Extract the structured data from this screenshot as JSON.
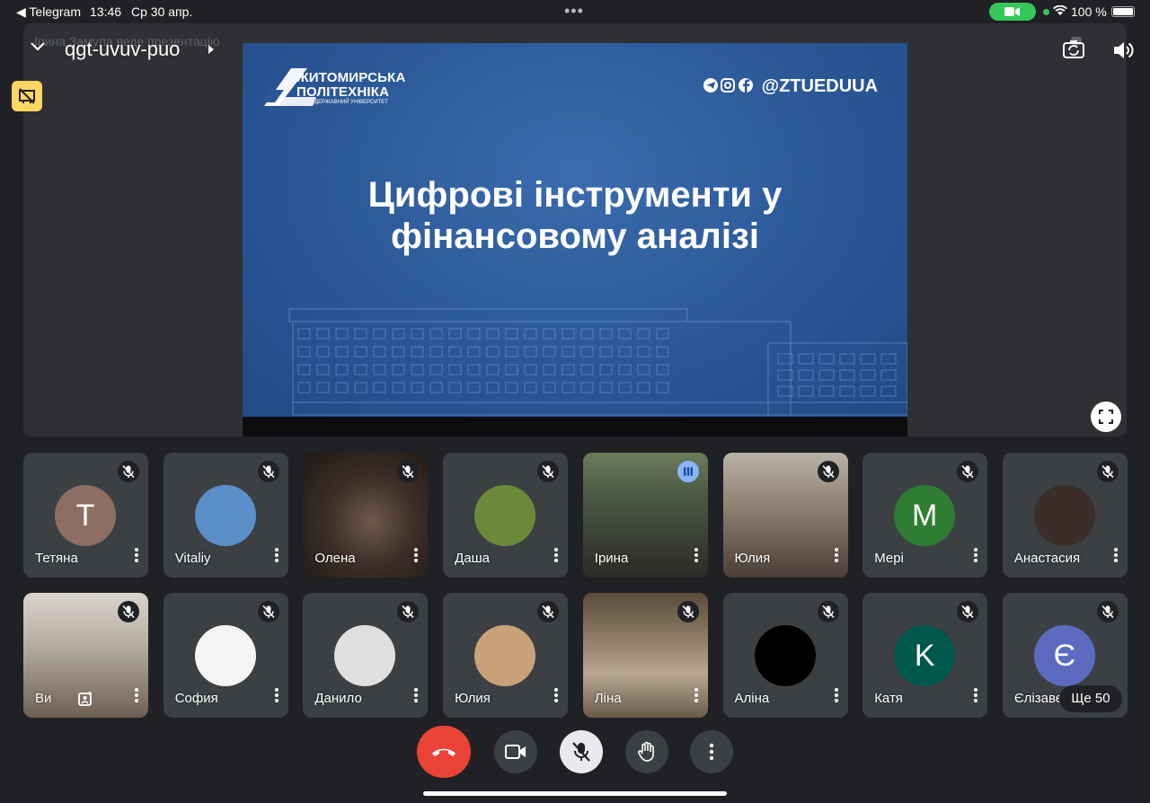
{
  "status_bar": {
    "back_app": "◀ Telegram",
    "time": "13:46",
    "date": "Ср 30 апр.",
    "battery": "100 %"
  },
  "meeting": {
    "presenter_note": "Ірина Замула веде презентацію",
    "code": "qgt-uvuv-puo"
  },
  "slide": {
    "logo_line1": "ЖИТОМИРСЬКА",
    "logo_line2": "ПОЛІТЕХНІКА",
    "logo_line3": "ДЕРЖАВНИЙ УНІВЕРСИТЕТ",
    "social_handle": "@ZTUEDUUA",
    "title_line1": "Цифрові інструменти у",
    "title_line2": "фінансовому аналізі"
  },
  "participants_row1": [
    {
      "name": "Тетяна",
      "initial": "T",
      "avatar_color": "#8d6e63",
      "state": "muted"
    },
    {
      "name": "Vitaliy",
      "initial": "",
      "avatar_color": "#5b8fc9",
      "state": "muted"
    },
    {
      "name": "Олена",
      "initial": "",
      "avatar_color": "",
      "state": "muted"
    },
    {
      "name": "Даша",
      "initial": "",
      "avatar_color": "#6a8a3a",
      "state": "muted"
    },
    {
      "name": "Ірина",
      "initial": "",
      "avatar_color": "",
      "state": "speaking"
    },
    {
      "name": "Юлия",
      "initial": "",
      "avatar_color": "",
      "state": "muted"
    },
    {
      "name": "Мері",
      "initial": "M",
      "avatar_color": "#2e7d32",
      "state": "muted"
    },
    {
      "name": "Анастасия",
      "initial": "",
      "avatar_color": "#3a2d2a",
      "state": "muted"
    }
  ],
  "participants_row2": [
    {
      "name": "Ви",
      "initial": "",
      "avatar_color": "",
      "state": "muted"
    },
    {
      "name": "София",
      "initial": "",
      "avatar_color": "#f5f5f5",
      "state": "muted"
    },
    {
      "name": "Данило",
      "initial": "",
      "avatar_color": "#e0e0e0",
      "state": "muted"
    },
    {
      "name": "Юлия",
      "initial": "",
      "avatar_color": "#c9a27a",
      "state": "muted"
    },
    {
      "name": "Ліна",
      "initial": "",
      "avatar_color": "",
      "state": "muted"
    },
    {
      "name": "Аліна",
      "initial": "",
      "avatar_color": "#000000",
      "state": "muted"
    },
    {
      "name": "Катя",
      "initial": "K",
      "avatar_color": "#00574b",
      "state": "muted"
    },
    {
      "name": "Єлізаве",
      "initial": "Є",
      "avatar_color": "#5c6bc0",
      "state": "muted"
    }
  ],
  "more_people": "Ще 50",
  "controls": {
    "end_call_color": "#ea4335",
    "icons": [
      "phone-end-icon",
      "camera-icon",
      "mic-off-icon",
      "raise-hand-icon",
      "more-vert-icon"
    ]
  }
}
